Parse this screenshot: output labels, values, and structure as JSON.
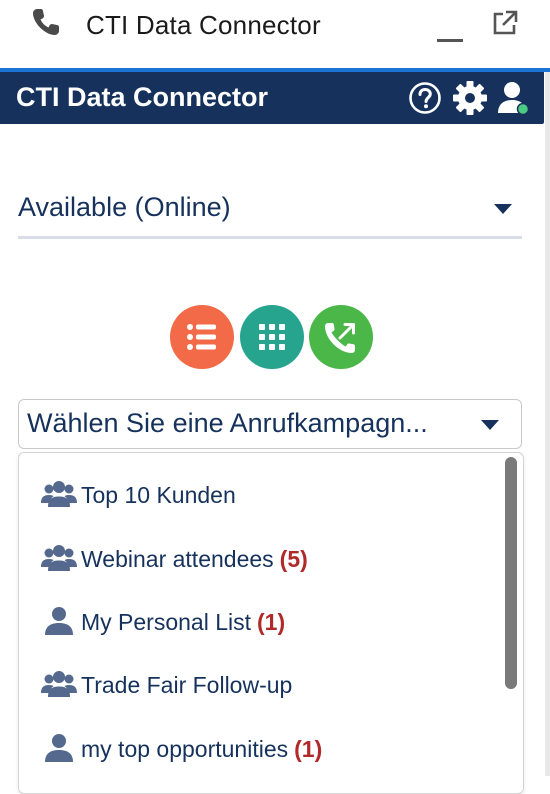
{
  "window": {
    "title": "CTI Data Connector",
    "icons": [
      "phone-icon",
      "minimize-icon",
      "popout-icon"
    ]
  },
  "header": {
    "title": "CTI Data Connector",
    "icons": [
      "help-icon",
      "gear-icon",
      "user-status-icon"
    ],
    "background": "#16325c"
  },
  "status": {
    "value": "Available (Online)"
  },
  "actions": [
    {
      "name": "call-list-button",
      "icon": "list-icon",
      "color": "#f26a48"
    },
    {
      "name": "dialpad-button",
      "icon": "dialpad-icon",
      "color": "#26a48e"
    },
    {
      "name": "outbound-call-button",
      "icon": "outbound-call-icon",
      "color": "#4bb749"
    }
  ],
  "campaign": {
    "placeholder": "Wählen Sie eine Anrufkampagn..."
  },
  "campaign_list": [
    {
      "label": "Top 10 Kunden",
      "count": "",
      "icon": "group-icon"
    },
    {
      "label": "Webinar attendees",
      "count": "(5)",
      "icon": "group-icon"
    },
    {
      "label": "My Personal List",
      "count": "(1)",
      "icon": "person-icon"
    },
    {
      "label": "Trade Fair Follow-up",
      "count": "",
      "icon": "group-icon"
    },
    {
      "label": "my top opportunities",
      "count": "(1)",
      "icon": "person-icon"
    }
  ],
  "colors": {
    "accent_line": "#1b74d4",
    "count": "#b02a2a",
    "text": "#16325c",
    "online": "#4bca81"
  }
}
